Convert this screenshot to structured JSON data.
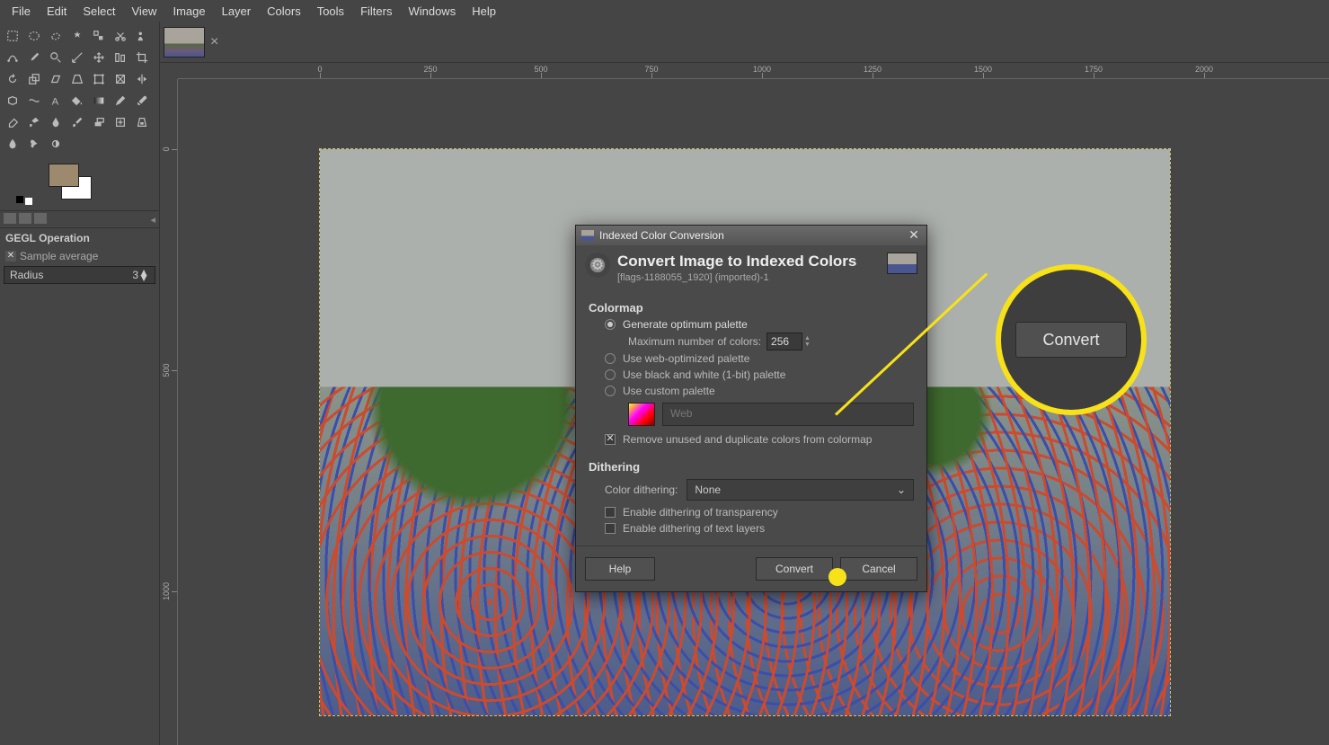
{
  "menu": {
    "file": "File",
    "edit": "Edit",
    "select": "Select",
    "view": "View",
    "image": "Image",
    "layer": "Layer",
    "colors": "Colors",
    "tools": "Tools",
    "filters": "Filters",
    "windows": "Windows",
    "help": "Help"
  },
  "tooloptions": {
    "title": "GEGL Operation",
    "sample_avg": "Sample average",
    "radius_label": "Radius",
    "radius_value": "3"
  },
  "ruler_h": [
    "0",
    "250",
    "500",
    "750",
    "1000",
    "1250",
    "1500",
    "1750",
    "2000"
  ],
  "ruler_v": [
    "0",
    "500",
    "1000"
  ],
  "dialog": {
    "titlebar": "Indexed Color Conversion",
    "heading": "Convert Image to Indexed Colors",
    "sub": "[flags-1188055_1920] (imported)-1",
    "colormap_h": "Colormap",
    "opt_gen": "Generate optimum palette",
    "max_label": "Maximum number of colors:",
    "max_value": "256",
    "opt_web": "Use web-optimized palette",
    "opt_bw": "Use black and white (1-bit) palette",
    "opt_custom": "Use custom palette",
    "palette_name": "Web",
    "remove_dup": "Remove unused and duplicate colors from colormap",
    "dither_h": "Dithering",
    "dither_label": "Color dithering:",
    "dither_value": "None",
    "dither_trans": "Enable dithering of transparency",
    "dither_text": "Enable dithering of text layers",
    "btn_help": "Help",
    "btn_convert": "Convert",
    "btn_cancel": "Cancel"
  },
  "callout": {
    "label": "Convert"
  }
}
